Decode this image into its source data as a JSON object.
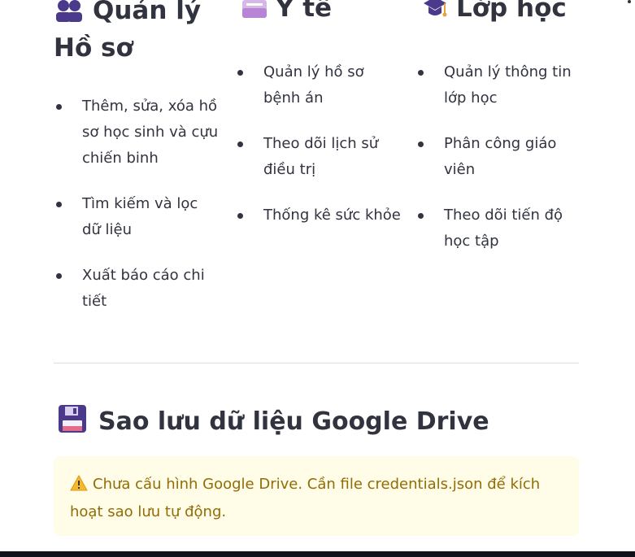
{
  "columns": [
    {
      "icon": "people-icon",
      "title": "Quản lý Hồ sơ",
      "items": [
        "Thêm, sửa, xóa hồ sơ học sinh và cựu chiến binh",
        "Tìm kiếm và lọc dữ liệu",
        "Xuất báo cáo chi tiết"
      ]
    },
    {
      "icon": "card-file-icon",
      "title": "Y tế",
      "items": [
        "Quản lý hồ sơ bệnh án",
        "Theo dõi lịch sử điều trị",
        "Thống kê sức khỏe"
      ]
    },
    {
      "icon": "graduation-cap-icon",
      "title": "Lớp học",
      "items": [
        "Quản lý thông tin lớp học",
        "Phân công giáo viên",
        "Theo dõi tiến độ học tập"
      ]
    }
  ],
  "backup": {
    "icon": "floppy-disk-icon",
    "title": "Sao lưu dữ liệu Google Drive",
    "alert_icon": "warning-icon",
    "alert_text": "Chưa cấu hình Google Drive. Cần file credentials.json để kích hoạt sao lưu tự động."
  },
  "colors": {
    "text": "#31333f",
    "alert_bg": "#fffce7",
    "alert_text": "#926c05"
  }
}
